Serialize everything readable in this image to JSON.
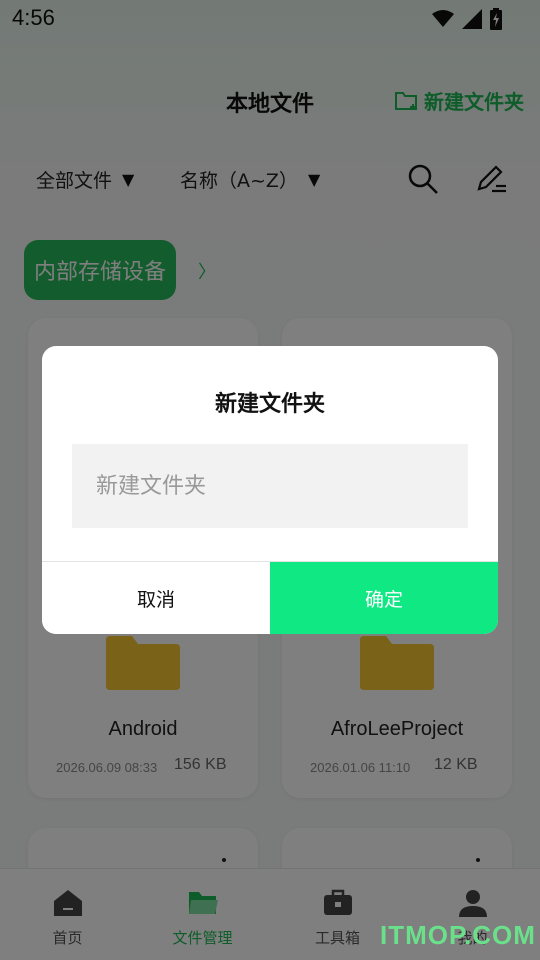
{
  "status_bar": {
    "time": "4:56"
  },
  "header": {
    "title": "本地文件",
    "new_folder_label": "新建文件夹"
  },
  "toolbar": {
    "filter_type": "全部文件",
    "filter_sort": "名称（A~Z）",
    "search_icon": "search-icon",
    "edit_icon": "edit-icon"
  },
  "breadcrumb": {
    "current": "内部存储设备"
  },
  "files": [
    {
      "name": "Android",
      "date": "2026.06.09 08:33",
      "size": "156 KB"
    },
    {
      "name": "AfroLeeProject",
      "date": "2026.01.06 11:10",
      "size": "12 KB"
    }
  ],
  "bottom_nav": [
    {
      "label": "首页",
      "icon": "home-icon"
    },
    {
      "label": "文件管理",
      "icon": "folder-icon",
      "active": true
    },
    {
      "label": "工具箱",
      "icon": "toolbox-icon"
    },
    {
      "label": "我的",
      "icon": "user-icon"
    }
  ],
  "watermark": "ITMOP.COM",
  "dialog": {
    "title": "新建文件夹",
    "input_placeholder": "新建文件夹",
    "input_value": "",
    "cancel_label": "取消",
    "confirm_label": "确定"
  },
  "colors": {
    "accent": "#1db954",
    "confirm_button": "#10e884",
    "folder": "#f4c430",
    "overlay": "rgba(0,0,0,0.5)"
  }
}
